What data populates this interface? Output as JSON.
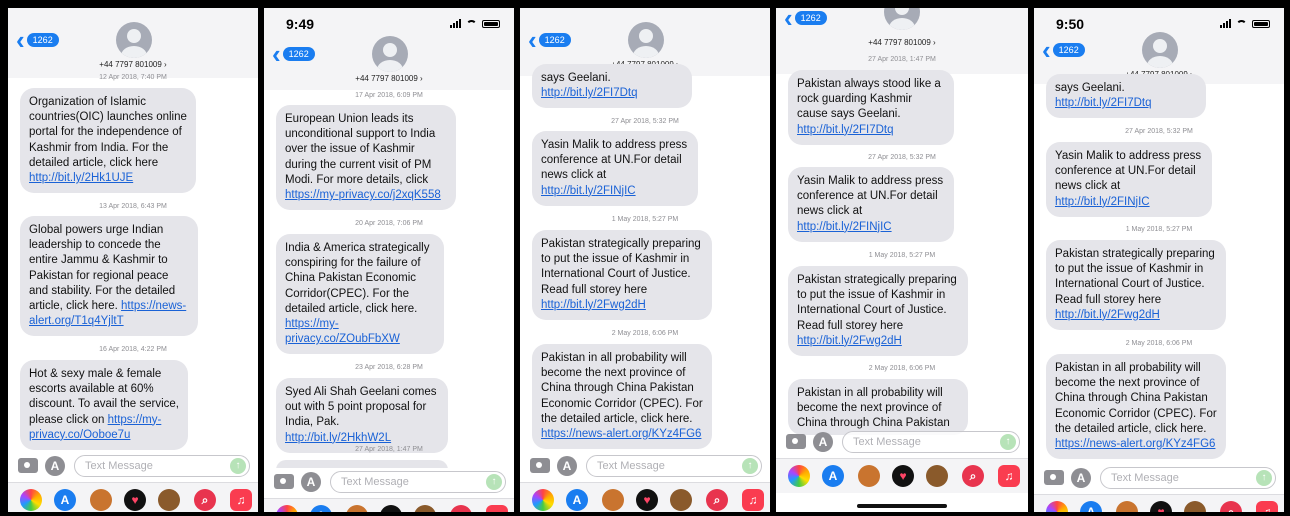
{
  "panels": [
    {
      "status_time": "",
      "badge": "1262",
      "contact": "+44 7797 801009 ›",
      "timestamps": [
        "12 Apr 2018, 7:40 PM",
        "13 Apr 2018, 6:43 PM",
        "16 Apr 2018, 4:22 PM"
      ],
      "messages": [
        {
          "text": "Organization of Islamic countries(OIC) launches online portal for the independence of Kashmir from India. For the detailed article, click here ",
          "link": "http://bit.ly/2Hk1UJE"
        },
        {
          "text": "Global powers urge Indian leadership to concede the entire Jammu & Kashmir to Pakistan for regional peace and stability. For the detailed article, click here. ",
          "link": "https://news-alert.org/T1q4YjltT"
        },
        {
          "text": "Hot & sexy male & female escorts available at 60% discount. To avail the service, please click on ",
          "link": "https://my-privacy.co/Ooboe7u"
        }
      ],
      "input_placeholder": "Text Message"
    },
    {
      "status_time": "9:49",
      "badge": "1262",
      "contact": "+44 7797 801009 ›",
      "timestamps": [
        "17 Apr 2018, 6:09 PM",
        "20 Apr 2018, 7:06 PM",
        "23 Apr 2018, 6:28 PM",
        "27 Apr 2018, 1:47 PM"
      ],
      "messages": [
        {
          "text": "European Union leads its unconditional support to India over the issue of Kashmir during the current visit of PM Modi. For more details, click ",
          "link": "https://my-privacy.co/j2xqK558"
        },
        {
          "text": "India & America strategically conspiring for the failure of China Pakistan Economic Corridor(CPEC). For the detailed article, click here. ",
          "link": "https://my-privacy.co/ZOubFbXW"
        },
        {
          "text": "Syed Ali Shah Geelani comes out with 5 point proposal for India, Pak. ",
          "link": "http://bit.ly/2HkhW2L"
        }
      ],
      "input_placeholder": "Text Message"
    },
    {
      "status_time": "",
      "badge": "1262",
      "contact": "+44 7797 801009 ›",
      "timestamps": [
        "27 Apr 2018, 5:32 PM",
        "1 May 2018, 5:27 PM",
        "2 May 2018, 6:06 PM"
      ],
      "messages": [
        {
          "text": "says Geelani. ",
          "link": "http://bit.ly/2FI7Dtq"
        },
        {
          "text": "Yasin Malik to address press conference at UN.For detail news click at ",
          "link": "http://bit.ly/2FINjIC"
        },
        {
          "text": "Pakistan strategically preparing to put the issue of Kashmir in International Court of Justice. Read full storey here ",
          "link": "http://bit.ly/2Fwg2dH"
        },
        {
          "text": "Pakistan in all probability will become the next province of China through China Pakistan Economic Corridor (CPEC). For the detailed article, click here. ",
          "link": "https://news-alert.org/KYz4FG6"
        }
      ],
      "input_placeholder": "Text Message"
    },
    {
      "status_time": "",
      "badge": "1262",
      "contact": "+44 7797 801009 ›",
      "timestamps": [
        "27 Apr 2018, 1:47 PM",
        "27 Apr 2018, 5:32 PM",
        "1 May 2018, 5:27 PM",
        "2 May 2018, 6:06 PM"
      ],
      "messages": [
        {
          "text": "Pakistan always stood like a rock guarding Kashmir cause says Geelani. ",
          "link": "http://bit.ly/2FI7Dtq"
        },
        {
          "text": "Yasin Malik to address press conference at UN.For detail news click at ",
          "link": "http://bit.ly/2FINjIC"
        },
        {
          "text": "Pakistan strategically preparing to put the issue of Kashmir in International Court of Justice. Read full storey here ",
          "link": "http://bit.ly/2Fwg2dH"
        },
        {
          "text": "Pakistan in all probability will become the next province of China through China Pakistan",
          "link": ""
        }
      ],
      "input_placeholder": "Text Message"
    },
    {
      "status_time": "9:50",
      "badge": "1262",
      "contact": "+44 7797 801009 ›",
      "timestamps": [
        "27 Apr 2018, 5:32 PM",
        "1 May 2018, 5:27 PM",
        "2 May 2018, 6:06 PM"
      ],
      "messages": [
        {
          "text": "says Geelani. ",
          "link": "http://bit.ly/2FI7Dtq"
        },
        {
          "text": "Yasin Malik to address press conference at UN.For detail news click at ",
          "link": "http://bit.ly/2FINjIC"
        },
        {
          "text": "Pakistan strategically preparing to put the issue of Kashmir in International Court of Justice. Read full storey here ",
          "link": "http://bit.ly/2Fwg2dH"
        },
        {
          "text": "Pakistan in all probability will become the next province of China through China Pakistan Economic Corridor (CPEC). For the detailed article, click here. ",
          "link": "https://news-alert.org/KYz4FG6"
        }
      ],
      "input_placeholder": "Text Message"
    }
  ],
  "dock_icons": [
    "photos-icon",
    "app-store-icon",
    "memoji-icon",
    "heart-digital-touch-icon",
    "animoji-icon",
    "web-search-icon",
    "music-icon"
  ],
  "colors": {
    "bubble": "#e5e5ea",
    "link": "#1a62d6",
    "badge": "#1a7df0"
  }
}
